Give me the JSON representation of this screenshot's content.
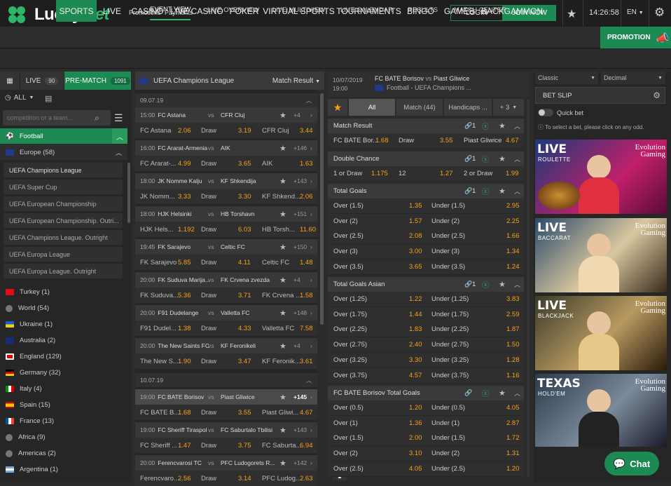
{
  "header": {
    "logo_a": "Lucky",
    "logo_b": "Bet",
    "promotions": "Promotions",
    "payments": "Payments",
    "login": "LOGIN",
    "join": "JOIN NOW",
    "time": "14:26:58",
    "lang": "EN"
  },
  "nav": {
    "items": [
      "SPORTS",
      "LIVE",
      "CASINO",
      "LIVE CASINO",
      "POKER",
      "VIRTUAL SPORTS",
      "TOURNAMENTS",
      "BINGO",
      "GAMES",
      "BACKGAMMON"
    ],
    "promotion": "PROMOTION"
  },
  "subnav": {
    "items": [
      "EVENT VIEW",
      "LIVE OVERVIEW",
      "LIVE MULTIVIEW",
      "LIVE CALENDAR",
      "RESULTS",
      "MATCH CENTER"
    ]
  },
  "sidebar": {
    "tabs": {
      "live": "LIVE",
      "live_count": "90",
      "prematch": "PRE-MATCH",
      "prematch_count": "1091"
    },
    "all": "ALL",
    "search_placeholder": "competition or a team...",
    "sport": "Football",
    "region": "Europe (58)",
    "leagues": [
      "UEFA Champions League",
      "UEFA Super Cup",
      "UEFA European Championship",
      "UEFA European Championship. Outri...",
      "UEFA Champions League. Outright",
      "UEFA Europa League",
      "UEFA Europa League. Outright"
    ],
    "countries": [
      "Turkey (1)",
      "World (54)",
      "Ukraine (1)",
      "Australia (2)",
      "England (129)",
      "Germany (32)",
      "Italy (4)",
      "Spain (15)",
      "France (13)",
      "Africa (9)",
      "Americas (2)",
      "Argentina (1)"
    ]
  },
  "events": {
    "competition": "UEFA Champions League",
    "market": "Match Result",
    "date1": "09.07.19",
    "date2": "10.07.19",
    "draw": "Draw",
    "vs": "vs",
    "list": [
      {
        "time": "15:00",
        "home": "FC Astana",
        "away": "CFR Cluj",
        "more": "+4",
        "h": "FC Astana",
        "o1": "2.06",
        "ox": "3.19",
        "a": "CFR Cluj",
        "o2": "3.44"
      },
      {
        "time": "16:00",
        "home": "FC Ararat-Armenia",
        "away": "AIK",
        "more": "+146",
        "h": "FC Ararat-...",
        "o1": "4.99",
        "ox": "3.65",
        "a": "AIK",
        "o2": "1.63"
      },
      {
        "time": "18:00",
        "home": "JK Nomme Kalju",
        "away": "KF Shkendija",
        "more": "+143",
        "h": "JK Nomm...",
        "o1": "3.33",
        "ox": "3.30",
        "a": "KF Shkend...",
        "o2": "2.06"
      },
      {
        "time": "18:00",
        "home": "HJK Helsinki",
        "away": "HB Torshavn",
        "more": "+151",
        "h": "HJK Hels...",
        "o1": "1.192",
        "ox": "6.03",
        "a": "HB Torsh...",
        "o2": "11.60"
      },
      {
        "time": "19:45",
        "home": "FK Sarajevo",
        "away": "Celtic FC",
        "more": "+150",
        "h": "FK Sarajevo",
        "o1": "5.85",
        "ox": "4.11",
        "a": "Celtic FC",
        "o2": "1.48"
      },
      {
        "time": "20:00",
        "home": "FK Suduva Marija...",
        "away": "FK Crvena zvezda",
        "more": "+4",
        "h": "FK Suduva...",
        "o1": "5.36",
        "ox": "3.71",
        "a": "FK Crvena ...",
        "o2": "1.58"
      },
      {
        "time": "20:00",
        "home": "F91 Dudelange",
        "away": "Valletta FC",
        "more": "+148",
        "h": "F91 Dudel...",
        "o1": "1.38",
        "ox": "4.33",
        "a": "Valletta FC",
        "o2": "7.58"
      },
      {
        "time": "20:00",
        "home": "The New Saints FC",
        "away": "KF Feronikeli",
        "more": "+4",
        "h": "The New S...",
        "o1": "1.90",
        "ox": "3.47",
        "a": "KF Feronik...",
        "o2": "3.61"
      },
      {
        "time": "19:00",
        "home": "FC BATE Borisov",
        "away": "Piast Gliwice",
        "more": "+145",
        "h": "FC BATE B...",
        "o1": "1.68",
        "ox": "3.55",
        "a": "Piast Gliwi...",
        "o2": "4.67"
      },
      {
        "time": "19:00",
        "home": "FC Sheriff Tiraspol",
        "away": "FC Saburtalo Tbilisi",
        "more": "+143",
        "h": "FC Sheriff ...",
        "o1": "1.47",
        "ox": "3.75",
        "a": "FC Saburta...",
        "o2": "6.94"
      },
      {
        "time": "20:00",
        "home": "Ferencvarosi TC",
        "away": "PFC Ludogorets R...",
        "more": "+142",
        "h": "Ferencvaro...",
        "o1": "2.56",
        "ox": "3.14",
        "a": "PFC Ludog...",
        "o2": "2.63"
      }
    ]
  },
  "match": {
    "date": "10/07/2019",
    "time": "19:00",
    "home": "FC BATE Borisov",
    "vs": "vs",
    "away": "Piast Gliwice",
    "comp": "Football - UEFA Champions ...",
    "tabs": [
      "All",
      "Match (44)",
      "Handicaps ...",
      "+ 3"
    ],
    "mr": {
      "title": "Match Result",
      "n": "1",
      "h": "FC BATE Bor...",
      "o1": "1.68",
      "x": "Draw",
      "ox": "3.55",
      "a": "Piast Gliwice",
      "o2": "4.67"
    },
    "dc": {
      "title": "Double Chance",
      "n": "1",
      "l1": "1 or Draw",
      "o1": "1.175",
      "l2": "12",
      "o2": "1.27",
      "l3": "2 or Draw",
      "o3": "1.99"
    },
    "tg": {
      "title": "Total Goals",
      "n": "1",
      "rows": [
        [
          "Over (1.5)",
          "1.35",
          "Under (1.5)",
          "2.95"
        ],
        [
          "Over (2)",
          "1.57",
          "Under (2)",
          "2.25"
        ],
        [
          "Over (2.5)",
          "2.08",
          "Under (2.5)",
          "1.66"
        ],
        [
          "Over (3)",
          "3.00",
          "Under (3)",
          "1.34"
        ],
        [
          "Over (3.5)",
          "3.65",
          "Under (3.5)",
          "1.24"
        ]
      ]
    },
    "tga": {
      "title": "Total Goals Asian",
      "n": "1",
      "rows": [
        [
          "Over (1.25)",
          "1.22",
          "Under (1.25)",
          "3.83"
        ],
        [
          "Over (1.75)",
          "1.44",
          "Under (1.75)",
          "2.59"
        ],
        [
          "Over (2.25)",
          "1.83",
          "Under (2.25)",
          "1.87"
        ],
        [
          "Over (2.75)",
          "2.40",
          "Under (2.75)",
          "1.50"
        ],
        [
          "Over (3.25)",
          "3.30",
          "Under (3.25)",
          "1.28"
        ],
        [
          "Over (3.75)",
          "4.57",
          "Under (3.75)",
          "1.16"
        ]
      ]
    },
    "btg": {
      "title": "FC BATE Borisov Total Goals",
      "rows": [
        [
          "Over (0.5)",
          "1.20",
          "Under (0.5)",
          "4.05"
        ],
        [
          "Over (1)",
          "1.36",
          "Under (1)",
          "2.87"
        ],
        [
          "Over (1.5)",
          "2.00",
          "Under (1.5)",
          "1.72"
        ],
        [
          "Over (2)",
          "3.10",
          "Under (2)",
          "1.31"
        ],
        [
          "Over (2.5)",
          "4.05",
          "Under (2.5)",
          "1.20"
        ]
      ]
    }
  },
  "betslip": {
    "odds_type": "Classic",
    "odds_format": "Decimal",
    "title": "BET SLIP",
    "quick": "Quick bet",
    "hint": "To select a bet, please click on any odd."
  },
  "promos": [
    {
      "big": "LIVE",
      "small": "ROULETTE",
      "brand1": "Evolution",
      "brand2": "Gaming"
    },
    {
      "big": "LIVE",
      "small": "BACCARAT",
      "brand1": "Evolution",
      "brand2": "Gaming"
    },
    {
      "big": "LIVE",
      "small": "BLACKJACK",
      "brand1": "Evolution",
      "brand2": "Gaming"
    },
    {
      "big": "TEXAS",
      "small": "HOLD'EM",
      "brand1": "Evolution",
      "brand2": "Gaming"
    }
  ],
  "chat": "Chat"
}
